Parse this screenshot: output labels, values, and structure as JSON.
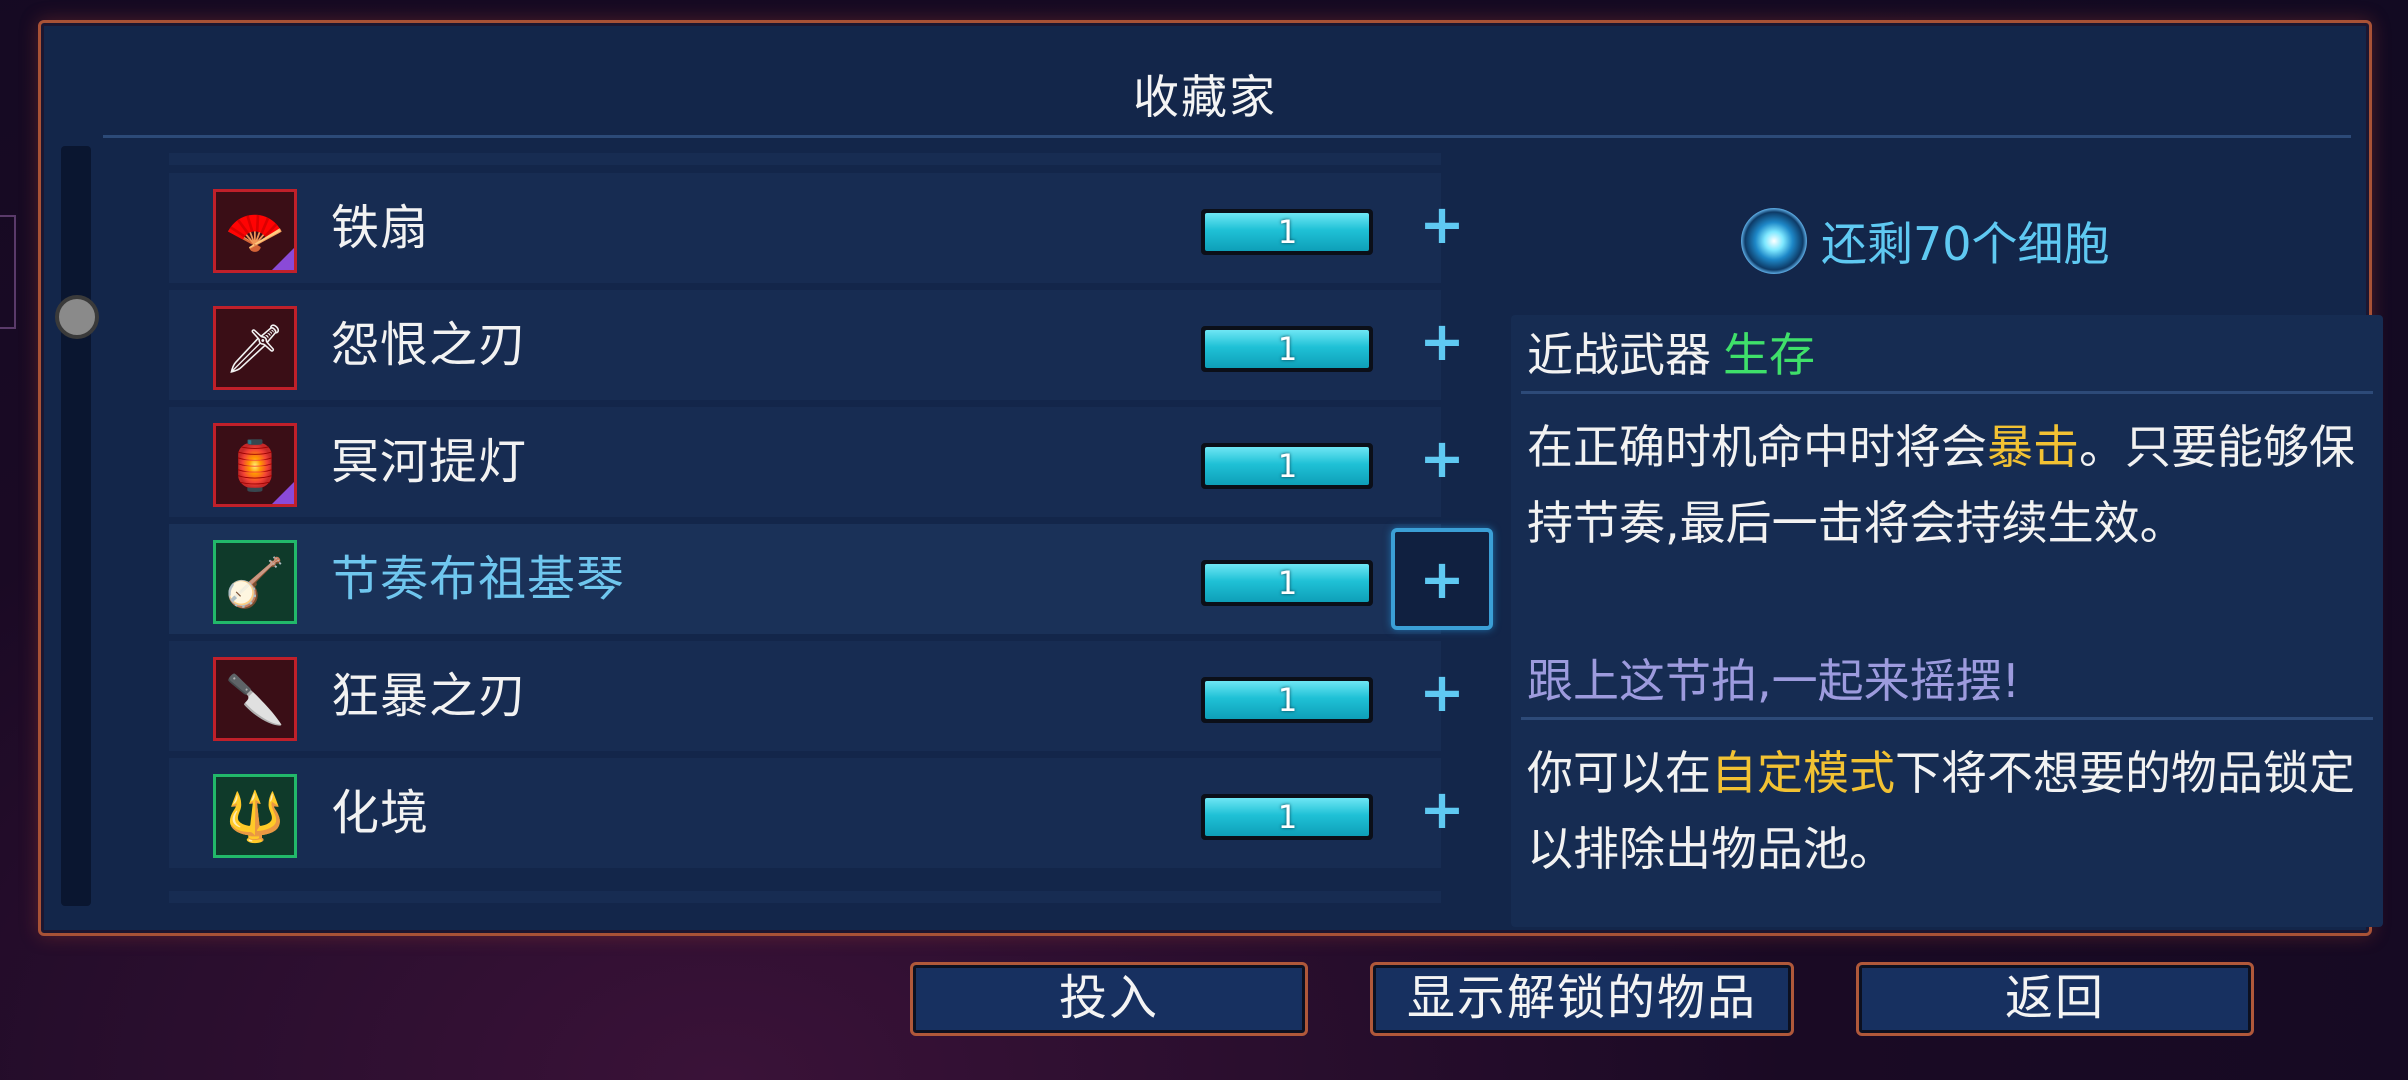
{
  "dialog": {
    "title": "收藏家"
  },
  "items": [
    {
      "name": "铁扇",
      "count": "1",
      "icon": "iron-fan-icon",
      "selected": false,
      "frame": "red",
      "legendary": true,
      "glyph": "🪭"
    },
    {
      "name": "怨恨之刃",
      "count": "1",
      "icon": "spite-blade-icon",
      "selected": false,
      "frame": "red",
      "legendary": false,
      "glyph": "🗡"
    },
    {
      "name": "冥河提灯",
      "count": "1",
      "icon": "styx-lantern-icon",
      "selected": false,
      "frame": "red",
      "legendary": true,
      "glyph": "🏮"
    },
    {
      "name": "节奏布祖基琴",
      "count": "1",
      "icon": "rhythm-bouzouki-icon",
      "selected": true,
      "frame": "green",
      "legendary": false,
      "glyph": "🪕"
    },
    {
      "name": "狂暴之刃",
      "count": "1",
      "icon": "frantic-blade-icon",
      "selected": false,
      "frame": "red",
      "legendary": false,
      "glyph": "🔪"
    },
    {
      "name": "化境",
      "count": "1",
      "icon": "transcendence-spear-icon",
      "selected": false,
      "frame": "green",
      "legendary": false,
      "glyph": "🔱"
    }
  ],
  "progress_fraction": 1.0,
  "cells_text": "还剩70个细胞",
  "detail": {
    "category": "近战武器",
    "scaling": "生存",
    "desc_pre": "在正确时机命中时将会",
    "desc_hl": "暴击",
    "desc_post": "。只要能够保持节奏,最后一击将会持续生效。",
    "flavor": "跟上这节拍,一起来摇摆!",
    "note_pre": "你可以在",
    "note_hl": "自定模式",
    "note_post": "下将不想要的物品锁定以排除出物品池。"
  },
  "buttons": {
    "invest": "投入",
    "show_unlocked": "显示解锁的物品",
    "back": "返回"
  },
  "colors": {
    "accent_blue": "#5fc9f2",
    "highlight_yellow": "#f2c233",
    "scaling_green": "#3fe06a",
    "flavor_purple": "#9d9bde",
    "frame_border": "#a85236"
  }
}
